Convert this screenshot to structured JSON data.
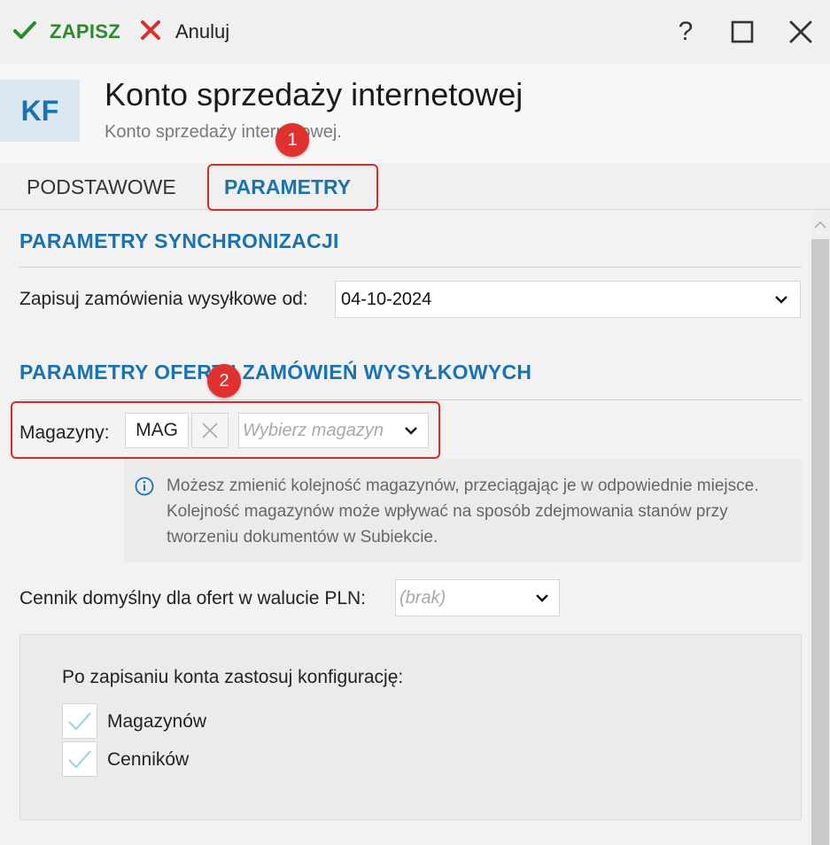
{
  "toolbar": {
    "save_label": "ZAPISZ",
    "cancel_label": "Anuluj",
    "help_label": "?"
  },
  "header": {
    "badge": "KF",
    "title": "Konto sprzedaży internetowej",
    "subtitle": "Konto sprzedaży internetowej."
  },
  "tabs": [
    {
      "label": "PODSTAWOWE",
      "active": false
    },
    {
      "label": "PARAMETRY",
      "active": true
    }
  ],
  "annotations": {
    "marker1": "1",
    "marker2": "2"
  },
  "sync": {
    "title": "PARAMETRY SYNCHRONIZACJI",
    "save_orders_label": "Zapisuj zamówienia wysyłkowe od:",
    "save_orders_value": "04-10-2024"
  },
  "offers": {
    "title": "PARAMETRY OFERT I ZAMÓWIEŃ WYSYŁKOWYCH",
    "warehouses_label": "Magazyny:",
    "warehouse_chip": "MAG",
    "warehouse_placeholder": "Wybierz magazyn",
    "info_text": "Możesz zmienić kolejność magazynów, przeciągając je w odpowiednie miejsce. Kolejność magazynów może wpływać na sposób zdejmowania stanów przy tworzeniu dokumentów w Subiekcie.",
    "pricelist_label": "Cennik domyślny dla ofert w walucie PLN:",
    "pricelist_value": "(brak)"
  },
  "config": {
    "title": "Po zapisaniu konta zastosuj konfigurację:",
    "options": [
      {
        "label": "Magazynów",
        "checked": true
      },
      {
        "label": "Cenników",
        "checked": true
      }
    ]
  },
  "colors": {
    "accent": "#1a73b0",
    "save_green": "#2c8a2c",
    "cancel_red": "#d9302c",
    "marker_red": "#e0312f",
    "check_blue": "#9fd3ea"
  }
}
